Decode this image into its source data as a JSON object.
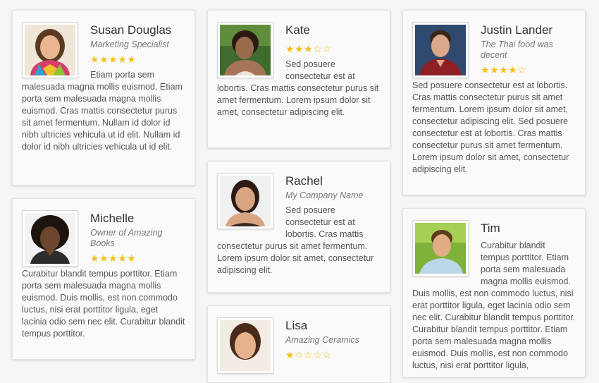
{
  "colors": {
    "star": "#f2c11b",
    "card_bg": "#fafafa",
    "page_bg": "#f5f5f5"
  },
  "cards": [
    {
      "name": "Susan Douglas",
      "role": "Marketing Specialist",
      "rating": 5,
      "bio": "Etiam porta sem malesuada magna mollis euismod. Etiam porta sem malesuada magna mollis euismod. Cras mattis consectetur purus sit amet fermentum. Nullam id dolor id nibh ultricies vehicula ut id elit. Nullam id dolor id nibh ultricies vehicula ut id elit."
    },
    {
      "name": "Kate",
      "role": "",
      "rating": 3,
      "bio": "Sed posuere consectetur est at lobortis. Cras mattis consectetur purus sit amet fermentum. Lorem ipsum dolor sit amet, consectetur adipiscing elit."
    },
    {
      "name": "Justin Lander",
      "role": "The Thai food was decent",
      "rating": 4,
      "bio": "Sed posuere consectetur est at lobortis. Cras mattis consectetur purus sit amet fermentum. Lorem ipsum dolor sit amet, consectetur adipiscing elit. Sed posuere consectetur est at lobortis. Cras mattis consectetur purus sit amet fermentum. Lorem ipsum dolor sit amet, consectetur adipiscing elit."
    },
    {
      "name": "Michelle",
      "role": "Owner of Amazing Books",
      "rating": 5,
      "bio": "Curabitur blandit tempus porttitor. Etiam porta sem malesuada magna mollis euismod. Duis mollis, est non commodo luctus, nisi erat porttitor ligula, eget lacinia odio sem nec elit. Curabitur blandit tempus porttitor."
    },
    {
      "name": "Rachel",
      "role": "My Company Name",
      "rating": 0,
      "bio": "Sed posuere consectetur est at lobortis. Cras mattis consectetur purus sit amet fermentum. Lorem ipsum dolor sit amet, consectetur adipiscing elit."
    },
    {
      "name": "Tim",
      "role": "",
      "rating": 0,
      "bio": "Curabitur blandit tempus porttitor. Etiam porta sem malesuada magna mollis euismod. Duis mollis, est non commodo luctus, nisi erat porttitor ligula, eget lacinia odio sem nec elit. Curabitur blandit tempus porttitor. Curabitur blandit tempus porttitor. Etiam porta sem malesuada magna mollis euismod. Duis mollis, est non commodo luctus, nisi erat porttitor ligula,"
    },
    {
      "name": "Lisa",
      "role": "Amazing Ceramics",
      "rating": 1,
      "bio": ""
    }
  ]
}
